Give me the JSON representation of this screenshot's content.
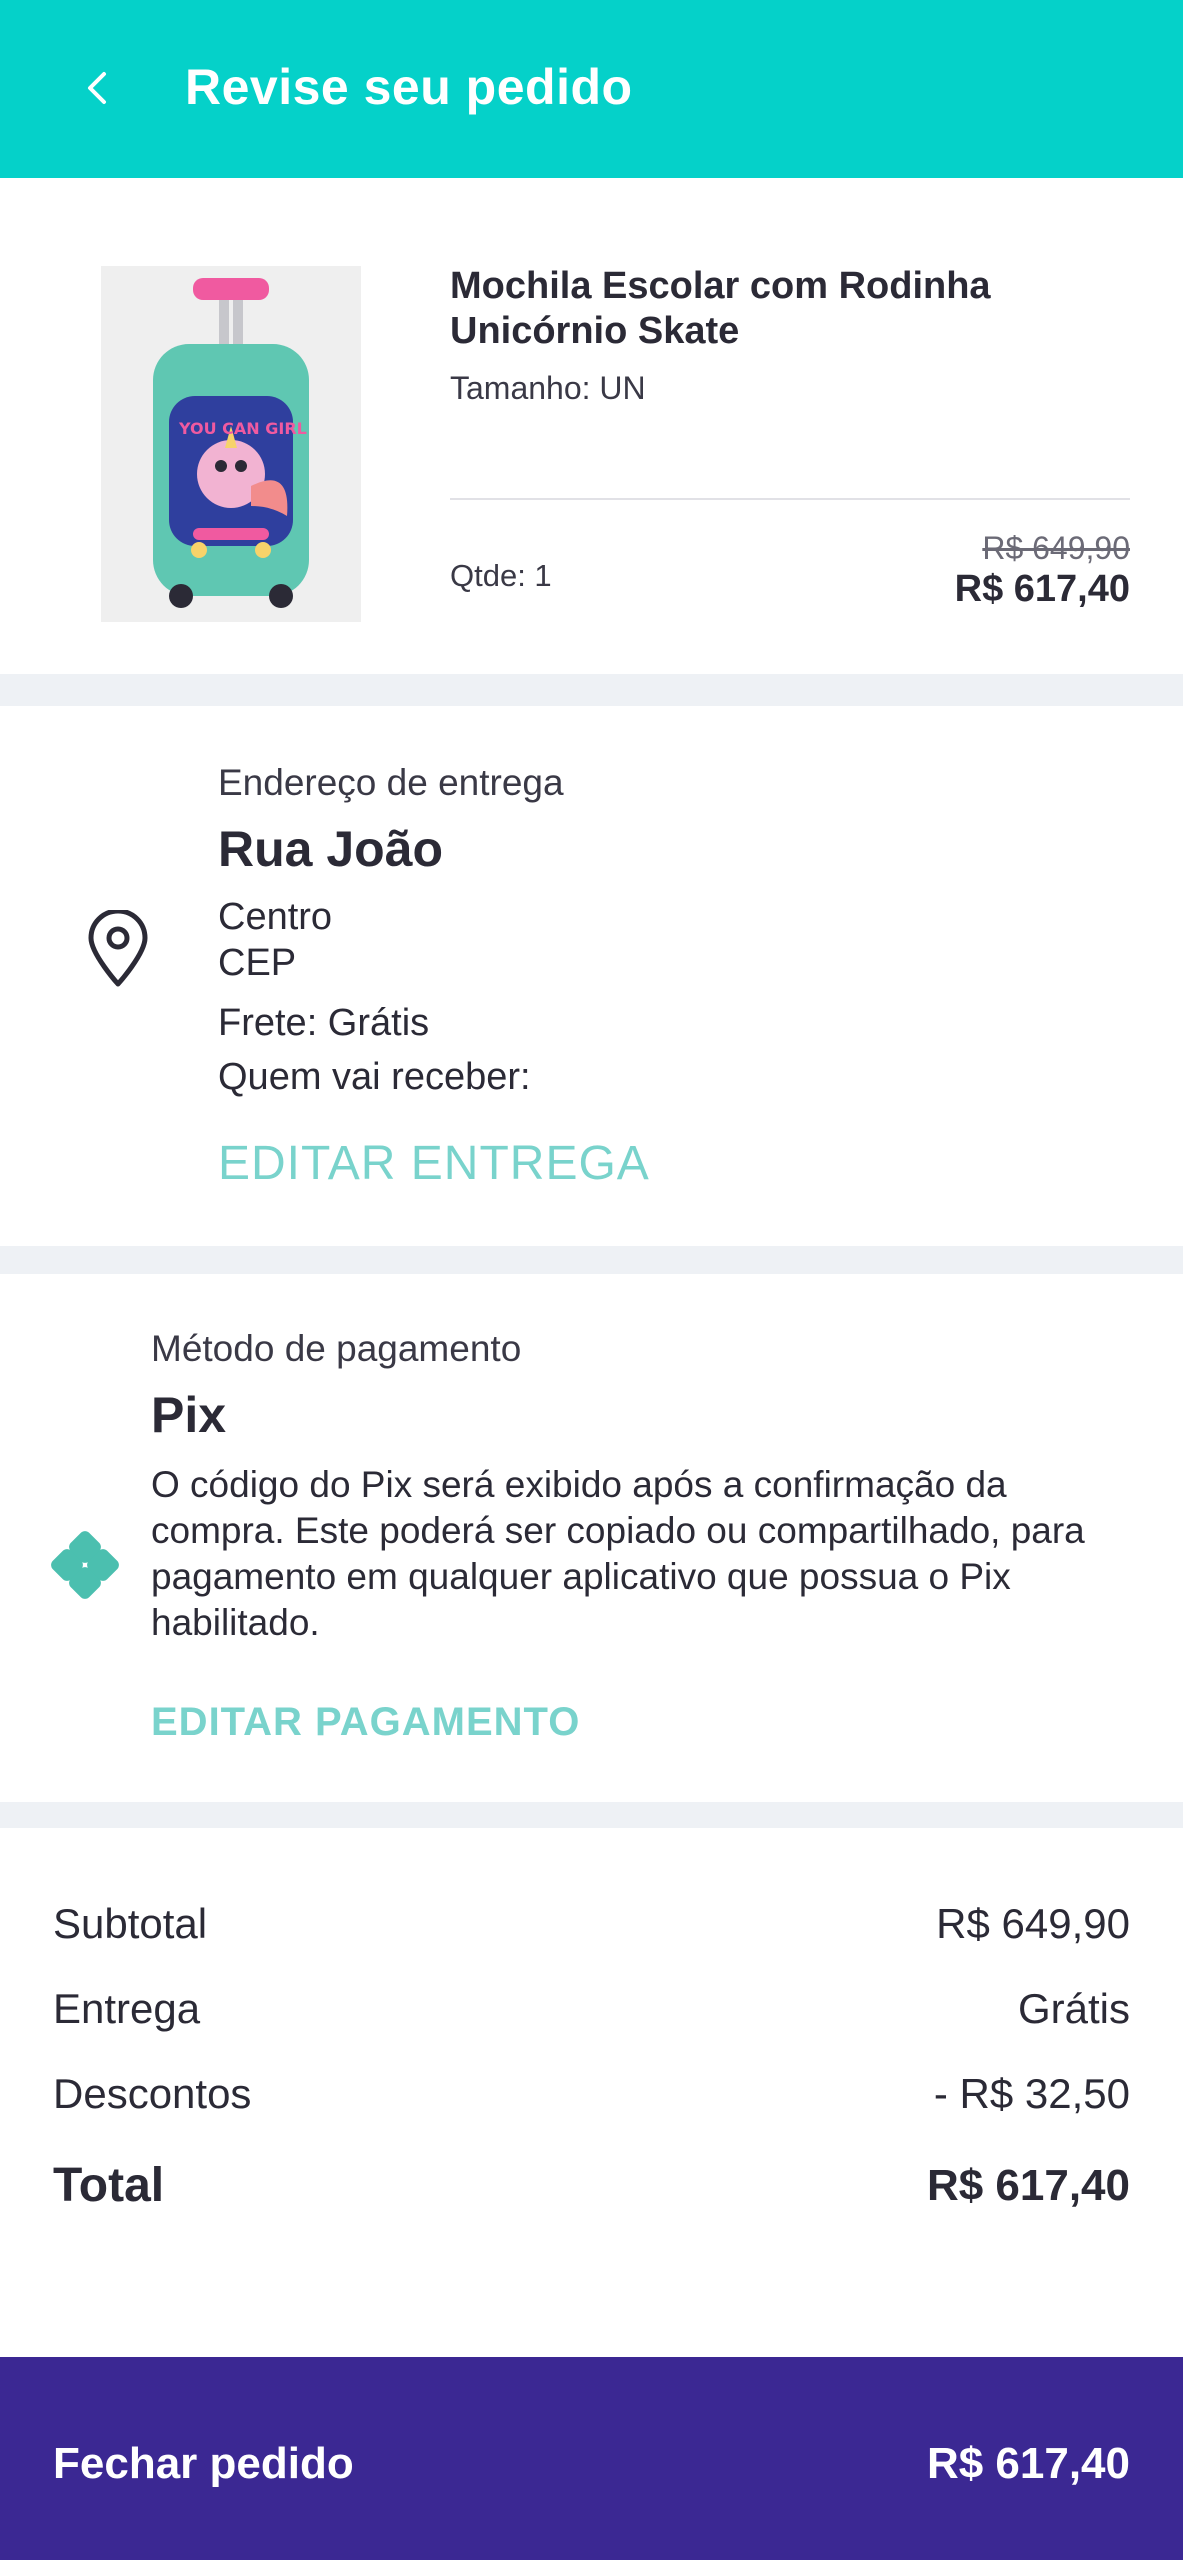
{
  "header": {
    "title": "Revise seu pedido",
    "back_icon": "chevron-left-icon"
  },
  "product": {
    "name": "Mochila Escolar com Rodinha Unicórnio Skate",
    "size": "Tamanho: UN",
    "quantity": "Qtde: 1",
    "old_price": "R$ 649,90",
    "price": "R$ 617,40",
    "image_text": "YOU CAN GIRL"
  },
  "delivery": {
    "title": "Endereço de entrega",
    "street": "Rua João",
    "neighborhood": "Centro",
    "cep": "CEP",
    "shipping": "Frete: Grátis",
    "receiver": "Quem vai receber:",
    "edit_label": "EDITAR ENTREGA",
    "icon": "location-pin-icon"
  },
  "payment": {
    "title": "Método de pagamento",
    "method": "Pix",
    "description": "O código do Pix será exibido após a confirmação da compra. Este poderá ser copiado ou compartilhado, para pagamento em qualquer aplicativo que possua o Pix habilitado.",
    "edit_label": "EDITAR PAGAMENTO",
    "icon": "pix-icon"
  },
  "summary": {
    "subtotal_label": "Subtotal",
    "subtotal_value": "R$ 649,90",
    "delivery_label": "Entrega",
    "delivery_value": "Grátis",
    "discount_label": "Descontos",
    "discount_value": "- R$ 32,50",
    "total_label": "Total",
    "total_value": "R$ 617,40"
  },
  "footer": {
    "label": "Fechar pedido",
    "amount": "R$ 617,40"
  },
  "colors": {
    "header": "#05d1c9",
    "accent": "#79d3cc",
    "footer": "#3b2893",
    "separator": "#eef1f5"
  }
}
